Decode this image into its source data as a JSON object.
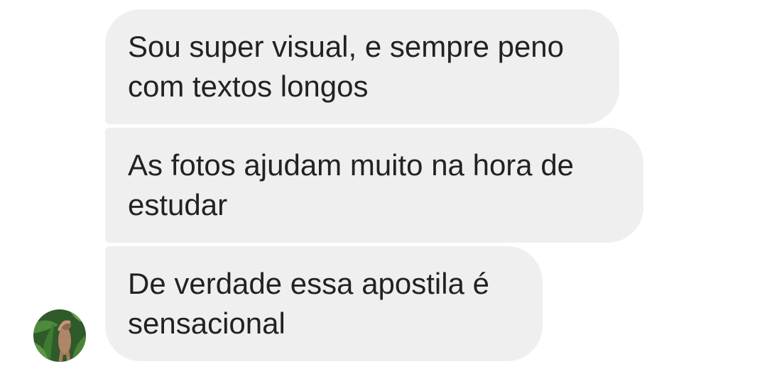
{
  "messages": [
    {
      "text": "Sou super visual, e sempre peno\ncom textos longos"
    },
    {
      "text": "As fotos ajudam muito na hora de\nestudar"
    },
    {
      "text": "De verdade essa apostila é\nsensacional"
    }
  ],
  "sender": {
    "avatar_icon": "profile-photo-avatar"
  },
  "colors": {
    "bubble_background": "#efefef",
    "text": "#222222",
    "background": "#ffffff"
  }
}
